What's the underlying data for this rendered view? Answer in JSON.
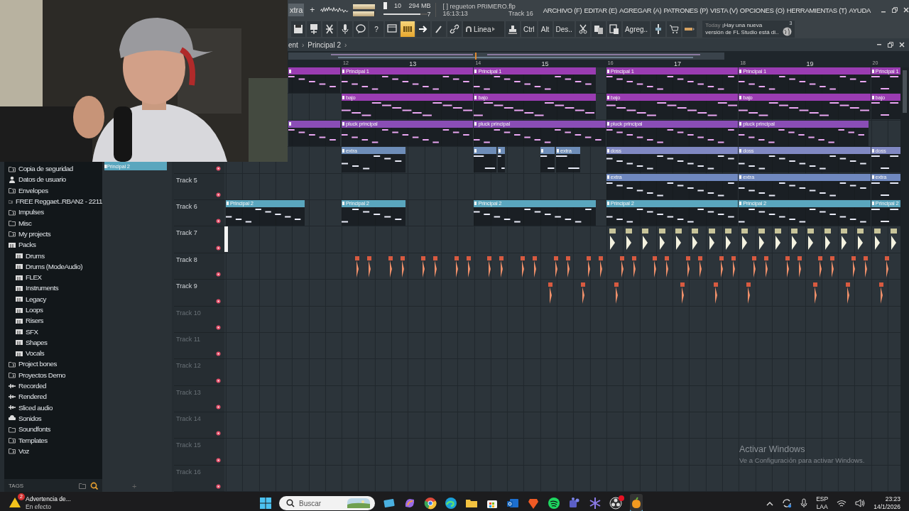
{
  "top_bar": {
    "pattern": "xtra",
    "add": "+",
    "volume": {
      "level": 1
    },
    "pitch": {
      "level": 0.97
    },
    "cpu": "10",
    "memory": "294 MB",
    "polyphony": "7",
    "cpu_meter": {
      "level": 0.85
    },
    "hint": {
      "file": "[ ] regueton PRIMERO.flp",
      "time": "16:13:13",
      "track": "Track 16"
    },
    "menu": [
      "ARCHIVO (F)",
      "EDITAR (E)",
      "AGREGAR (A)",
      "PATRONES (P)",
      "VISTA (V)",
      "OPCIONES (O)",
      "HERRAMIENTAS (T)",
      "AYUDA"
    ]
  },
  "toolbar": [
    {
      "kind": "save",
      "selected": false
    },
    {
      "kind": "save-new",
      "selected": false
    },
    {
      "kind": "cross",
      "selected": false
    },
    {
      "kind": "mic",
      "selected": false
    },
    {
      "kind": "chat",
      "selected": false
    },
    {
      "kind": "text",
      "label": "?",
      "selected": false
    },
    {
      "kind": "window",
      "selected": false
    },
    {
      "kind": "piano",
      "selected": true
    },
    {
      "kind": "arrow",
      "selected": false
    },
    {
      "kind": "brush",
      "selected": false
    },
    {
      "kind": "link",
      "selected": false
    },
    {
      "kind": "dropdown",
      "label": "Linea",
      "selected": false
    },
    {
      "kind": "stamp",
      "selected": false
    },
    {
      "kind": "text",
      "label": "Ctrl",
      "selected": false
    },
    {
      "kind": "text",
      "label": "Alt",
      "selected": false
    },
    {
      "kind": "text",
      "label": "Des..",
      "selected": false
    },
    {
      "kind": "scissors",
      "selected": false
    },
    {
      "kind": "copy",
      "selected": false
    },
    {
      "kind": "paste",
      "selected": false
    },
    {
      "kind": "text",
      "label": "Agreg..",
      "selected": false
    },
    {
      "kind": "fader",
      "selected": false
    },
    {
      "kind": "cart",
      "selected": false
    },
    {
      "kind": "color",
      "selected": false
    }
  ],
  "news": {
    "day": "Today",
    "line1": "¡Hay una nueva",
    "line2": "versión de FL Studio está di..",
    "count": "3"
  },
  "playlist": {
    "breadcrumb": [
      "ent",
      "›",
      "Principal 2",
      "›"
    ],
    "bars": [
      "12",
      "13",
      "14",
      "15",
      "16",
      "17",
      "18",
      "19",
      "20"
    ]
  },
  "browser": {
    "items": [
      {
        "label": "Copia de seguridad",
        "kind": "link"
      },
      {
        "label": "Datos de usuario",
        "kind": "user"
      },
      {
        "label": "Envelopes",
        "kind": "link"
      },
      {
        "label": "FREE Reggaet..RBAN2 - 2211",
        "kind": "link"
      },
      {
        "label": "Impulses",
        "kind": "link"
      },
      {
        "label": "Misc",
        "kind": "folder"
      },
      {
        "label": "My projects",
        "kind": "link"
      },
      {
        "label": "Packs",
        "kind": "pack",
        "children": [
          {
            "label": "Drums",
            "kind": "pack"
          },
          {
            "label": "Drums (ModeAudio)",
            "kind": "pack"
          },
          {
            "label": "FLEX",
            "kind": "pack"
          },
          {
            "label": "Instruments",
            "kind": "pack"
          },
          {
            "label": "Legacy",
            "kind": "pack"
          },
          {
            "label": "Loops",
            "kind": "pack"
          },
          {
            "label": "Risers",
            "kind": "pack"
          },
          {
            "label": "SFX",
            "kind": "pack"
          },
          {
            "label": "Shapes",
            "kind": "pack"
          },
          {
            "label": "Vocals",
            "kind": "pack"
          }
        ]
      },
      {
        "label": "Project bones",
        "kind": "link"
      },
      {
        "label": "Proyectos Demo",
        "kind": "link"
      },
      {
        "label": "Recorded",
        "kind": "audio"
      },
      {
        "label": "Rendered",
        "kind": "audio"
      },
      {
        "label": "Sliced audio",
        "kind": "audio"
      },
      {
        "label": "Sonidos",
        "kind": "cloud"
      },
      {
        "label": "Soundfonts",
        "kind": "folder"
      },
      {
        "label": "Templates",
        "kind": "link"
      },
      {
        "label": "Voz",
        "kind": "link"
      }
    ],
    "tags": "TAGS"
  },
  "picker": {
    "clip": "Principal 2",
    "add": "+"
  },
  "tracks": [
    {
      "kind": "patterns",
      "color": "#9a3cb2",
      "clips": [
        {
          "kind": "fragment"
        },
        {
          "kind": "pattern",
          "label": "Principal 1"
        },
        {
          "kind": "pattern",
          "label": "Principal 1"
        },
        {
          "kind": "pattern",
          "label": "Principal 1"
        },
        {
          "kind": "pattern",
          "label": "Principal 1"
        },
        {
          "kind": "pattern",
          "label": "Principal 1"
        }
      ]
    },
    {
      "kind": "patterns",
      "color": "#9a3cb2",
      "clips": [
        {
          "kind": "pattern",
          "label": "bajo"
        },
        {
          "kind": "pattern",
          "label": "bajo"
        },
        {
          "kind": "pattern",
          "label": "bajo"
        },
        {
          "kind": "pattern",
          "label": "bajo"
        },
        {
          "kind": "pattern",
          "label": "bajo"
        }
      ]
    },
    {
      "kind": "patterns",
      "color": "#8a4db6",
      "clips": [
        {
          "kind": "fragment"
        },
        {
          "kind": "pattern",
          "label": "pluck principal"
        },
        {
          "kind": "pattern",
          "label": "pluck principal"
        },
        {
          "kind": "pattern",
          "label": "pluck principal"
        },
        {
          "kind": "pattern",
          "label": "pluck principal"
        }
      ]
    },
    {
      "kind": "patterns",
      "color": "#6e8db8",
      "clips": [
        {
          "kind": "pattern",
          "label": "extra"
        },
        {
          "kind": "fragment"
        },
        {
          "kind": "fragment"
        },
        {
          "kind": "fragment"
        },
        {
          "kind": "pattern",
          "label": "extra"
        },
        {
          "kind": "pattern",
          "label": "doss",
          "color": "#8088c2"
        },
        {
          "kind": "pattern",
          "label": "doss",
          "color": "#8088c2"
        },
        {
          "kind": "pattern",
          "label": "doss",
          "color": "#8088c2"
        }
      ]
    },
    {
      "name": "Track 5",
      "kind": "patterns",
      "color": "#6f88bf",
      "clips": [
        {
          "kind": "pattern",
          "label": "extra"
        },
        {
          "kind": "pattern",
          "label": "extra"
        },
        {
          "kind": "pattern",
          "label": "extra"
        }
      ]
    },
    {
      "name": "Track 6",
      "kind": "patterns",
      "color": "#5aa6be",
      "clips": [
        {
          "kind": "pattern",
          "label": "Principal 2"
        },
        {
          "kind": "pattern",
          "label": "Principal 2"
        },
        {
          "kind": "pattern",
          "label": "Principal 2"
        },
        {
          "kind": "pattern",
          "label": "Principal 2"
        },
        {
          "kind": "pattern",
          "label": "Principal 2"
        },
        {
          "kind": "pattern",
          "label": "Principal 2"
        }
      ]
    },
    {
      "name": "Track 7",
      "kind": "samples"
    },
    {
      "name": "Track 8",
      "kind": "kicks"
    },
    {
      "name": "Track 9",
      "kind": "claps"
    },
    {
      "name": "Track 10",
      "kind": "empty"
    },
    {
      "name": "Track 11",
      "kind": "empty"
    },
    {
      "name": "Track 12",
      "kind": "empty"
    },
    {
      "name": "Track 13",
      "kind": "empty"
    },
    {
      "name": "Track 14",
      "kind": "empty"
    },
    {
      "name": "Track 15",
      "kind": "empty"
    },
    {
      "name": "Track 16",
      "kind": "empty"
    }
  ],
  "activation": {
    "title": "Activar Windows",
    "text": "Ve a Configuración para activar Windows."
  },
  "taskbar": {
    "notice": {
      "badge": "2",
      "title": "Advertencia de...",
      "subtitle": "En efecto"
    },
    "search": {
      "placeholder": "Buscar"
    },
    "apps": [
      {
        "kind": "tablet",
        "alert": false,
        "active": false
      },
      {
        "kind": "copilot",
        "alert": false,
        "active": false
      },
      {
        "kind": "chrome",
        "alert": false,
        "active": false
      },
      {
        "kind": "edge",
        "alert": false,
        "active": false
      },
      {
        "kind": "folder",
        "alert": false,
        "active": false
      },
      {
        "kind": "store",
        "alert": false,
        "active": false
      },
      {
        "kind": "outlook",
        "alert": false,
        "active": false
      },
      {
        "kind": "brave",
        "alert": false,
        "active": false
      },
      {
        "kind": "spotify",
        "alert": false,
        "active": false
      },
      {
        "kind": "teams",
        "alert": false,
        "active": false
      },
      {
        "kind": "snow",
        "alert": false,
        "active": false
      },
      {
        "kind": "obs",
        "alert": true,
        "active": false
      },
      {
        "kind": "fl",
        "alert": false,
        "active": true
      }
    ],
    "lang": "ESP",
    "region": "LAA",
    "time": "23:23",
    "date": "14/1/2026"
  }
}
